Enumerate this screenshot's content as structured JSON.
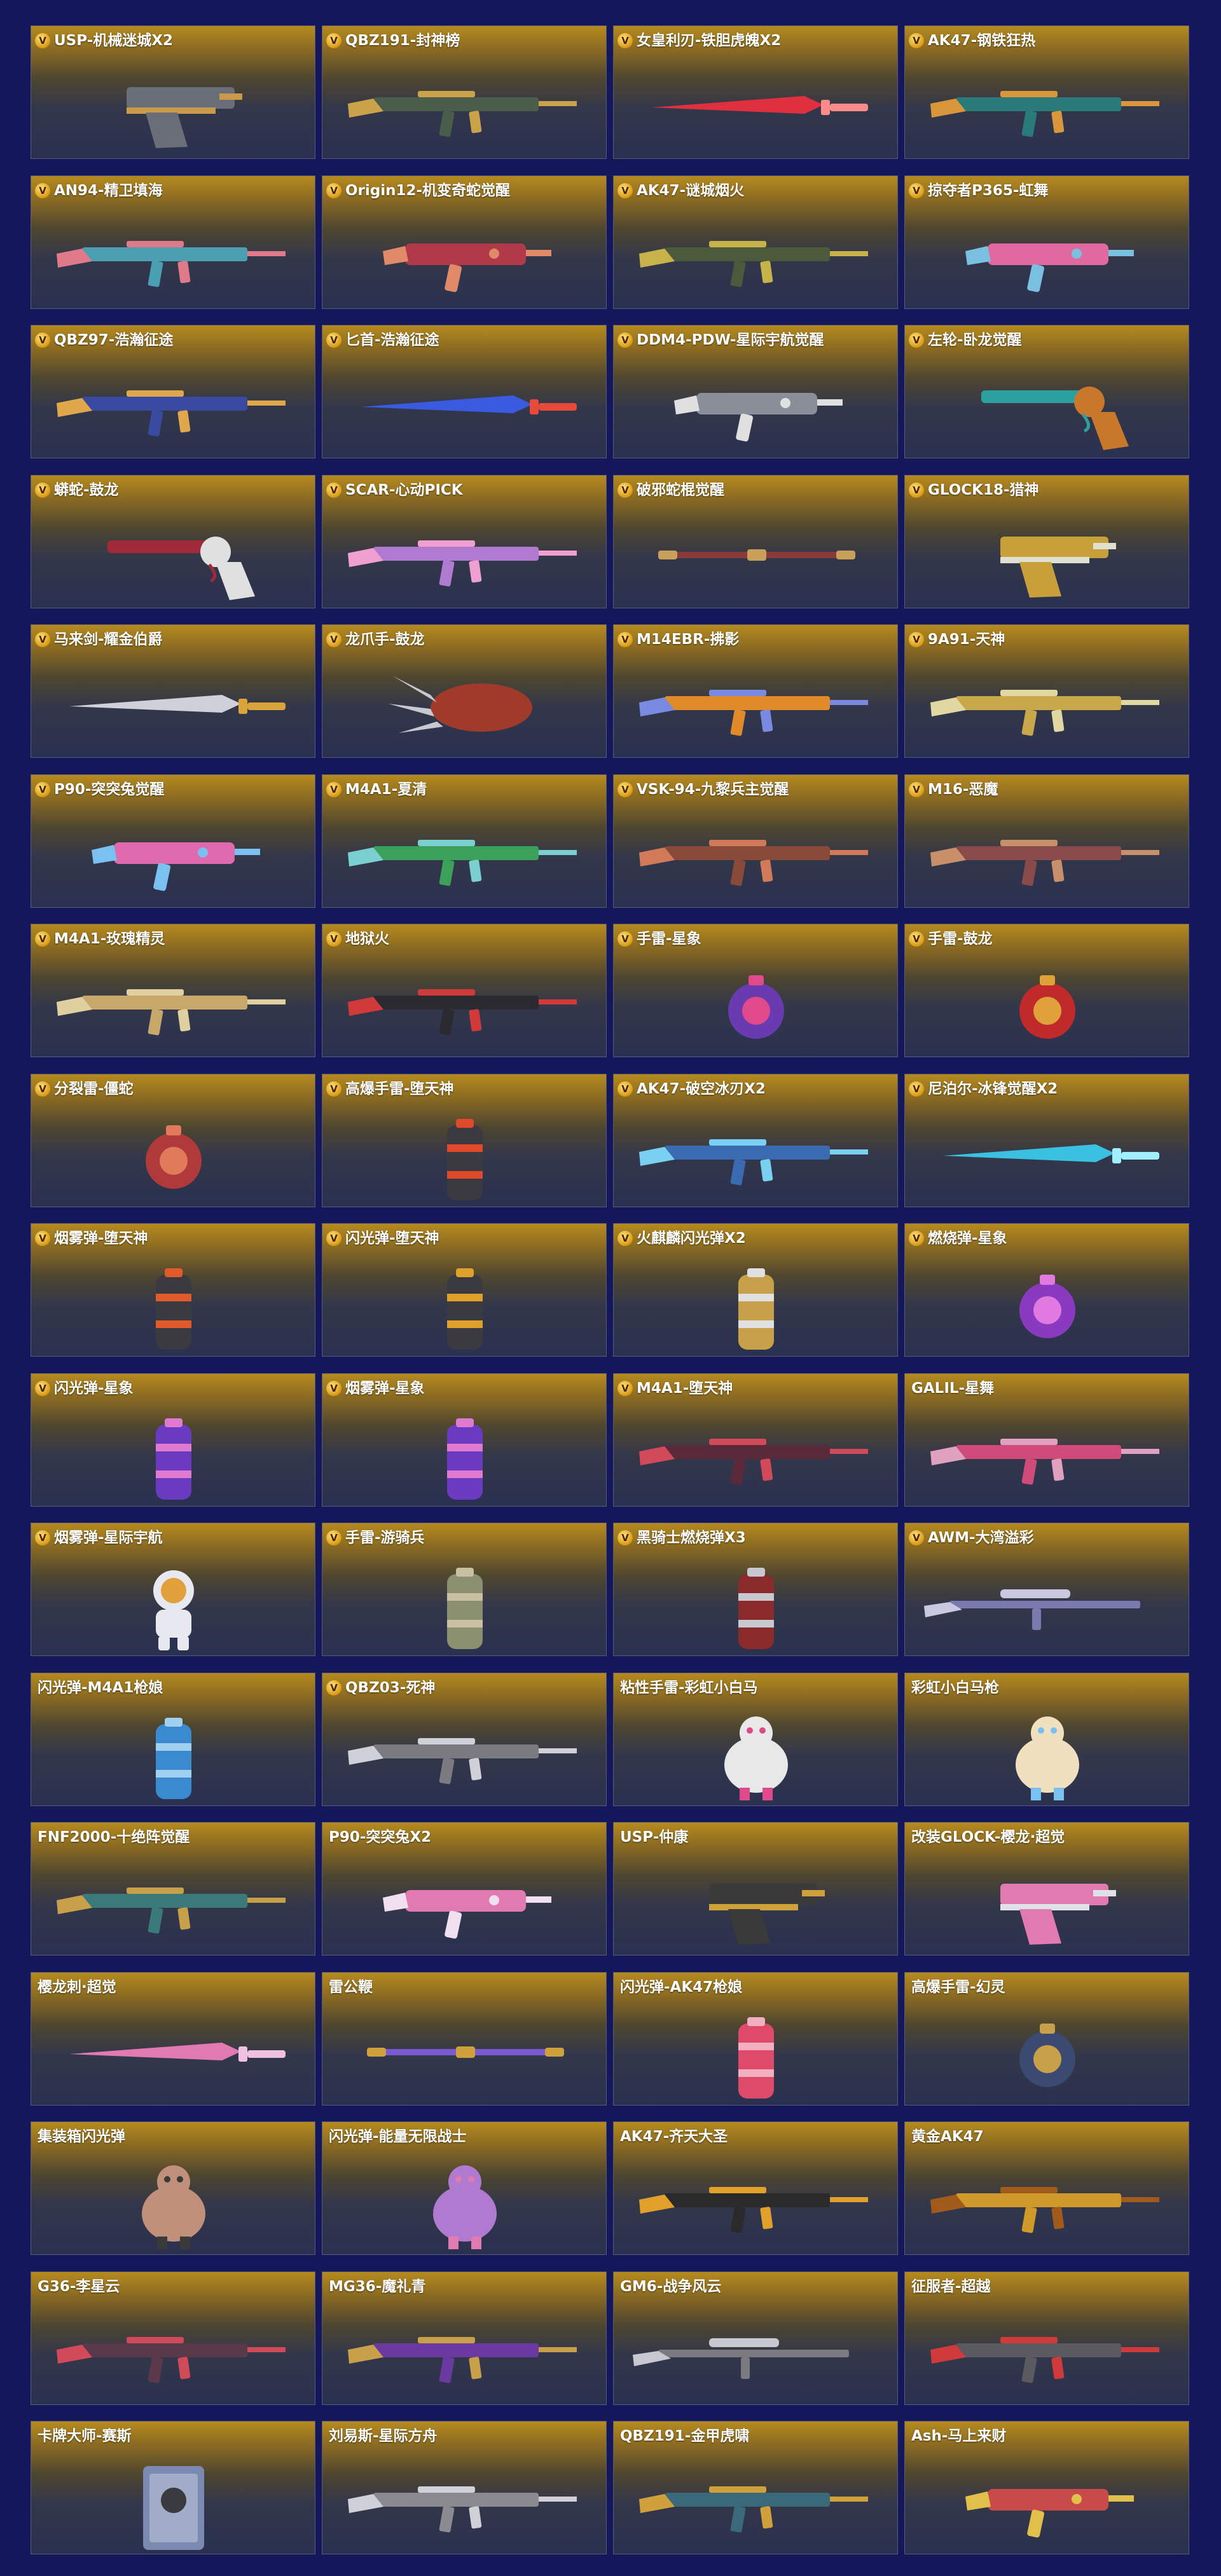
{
  "badge_letter": "V",
  "items": [
    {
      "title": "USP-机械迷城X2",
      "badge": true,
      "icon": "pistol-icon",
      "c1": "#6a6e78",
      "c2": "#c89a4a"
    },
    {
      "title": "QBZ191-封神榜",
      "badge": true,
      "icon": "rifle-icon",
      "c1": "#4a5c4a",
      "c2": "#c9a24a"
    },
    {
      "title": "女皇利刃-铁胆虎魄X2",
      "badge": true,
      "icon": "blade-icon",
      "c1": "#e03040",
      "c2": "#ff8a8a"
    },
    {
      "title": "AK47-钢铁狂热",
      "badge": true,
      "icon": "rifle-icon",
      "c1": "#2a7a7a",
      "c2": "#d9963a"
    },
    {
      "title": "AN94-精卫填海",
      "badge": true,
      "icon": "rifle-icon",
      "c1": "#4aa0b0",
      "c2": "#e07a8a"
    },
    {
      "title": "Origin12-机变奇蛇觉醒",
      "badge": true,
      "icon": "smg-icon",
      "c1": "#b03a4a",
      "c2": "#e08a6a"
    },
    {
      "title": "AK47-谜城烟火",
      "badge": true,
      "icon": "rifle-icon",
      "c1": "#4a5a3a",
      "c2": "#c8b24a"
    },
    {
      "title": "掠夺者P365-虹舞",
      "badge": true,
      "icon": "smg-icon",
      "c1": "#e06aa0",
      "c2": "#7ac0e0"
    },
    {
      "title": "QBZ97-浩瀚征途",
      "badge": true,
      "icon": "rifle-icon",
      "c1": "#3a4aa0",
      "c2": "#e0a84a"
    },
    {
      "title": "匕首-浩瀚征途",
      "badge": true,
      "icon": "blade-icon",
      "c1": "#3a5ae0",
      "c2": "#e84a3a"
    },
    {
      "title": "DDM4-PDW-星际宇航觉醒",
      "badge": true,
      "icon": "smg-icon",
      "c1": "#8a8e98",
      "c2": "#e0e0e0"
    },
    {
      "title": "左轮-卧龙觉醒",
      "badge": true,
      "icon": "revolver-icon",
      "c1": "#2aa0a0",
      "c2": "#c8782a"
    },
    {
      "title": "蟒蛇-鼓龙",
      "badge": true,
      "icon": "revolver-icon",
      "c1": "#a02a3a",
      "c2": "#e0e0e0"
    },
    {
      "title": "SCAR-心动PICK",
      "badge": true,
      "icon": "rifle-icon",
      "c1": "#b07ad0",
      "c2": "#f0a0d0"
    },
    {
      "title": "破邪蛇棍觉醒",
      "badge": true,
      "icon": "staff-icon",
      "c1": "#8a3a3a",
      "c2": "#c8a05a"
    },
    {
      "title": "GLOCK18-猎神",
      "badge": true,
      "icon": "pistol-icon",
      "c1": "#c8a03a",
      "c2": "#e0e0d0"
    },
    {
      "title": "马来剑-耀金伯爵",
      "badge": true,
      "icon": "blade-icon",
      "c1": "#d0d0d8",
      "c2": "#d9a43a"
    },
    {
      "title": "龙爪手-鼓龙",
      "badge": true,
      "icon": "claw-icon",
      "c1": "#a03a2a",
      "c2": "#c8c8d0"
    },
    {
      "title": "M14EBR-拂影",
      "badge": true,
      "icon": "rifle-icon",
      "c1": "#e08a2a",
      "c2": "#7a8ae0"
    },
    {
      "title": "9A91-天神",
      "badge": true,
      "icon": "rifle-icon",
      "c1": "#c8a84a",
      "c2": "#e0d8a0"
    },
    {
      "title": "P90-突突兔觉醒",
      "badge": true,
      "icon": "smg-icon",
      "c1": "#e06ab0",
      "c2": "#7ac0f0"
    },
    {
      "title": "M4A1-夏清",
      "badge": true,
      "icon": "rifle-icon",
      "c1": "#3aa05a",
      "c2": "#7ad0d0"
    },
    {
      "title": "VSK-94-九黎兵主觉醒",
      "badge": true,
      "icon": "rifle-icon",
      "c1": "#8a4a3a",
      "c2": "#d07a5a"
    },
    {
      "title": "M16-恶魔",
      "badge": true,
      "icon": "rifle-icon",
      "c1": "#8a4a4a",
      "c2": "#c8906a"
    },
    {
      "title": "M4A1-玫瑰精灵",
      "badge": true,
      "icon": "rifle-icon",
      "c1": "#c8a86a",
      "c2": "#e0d0a0"
    },
    {
      "title": "地狱火",
      "badge": true,
      "icon": "rifle-icon",
      "c1": "#2a2a30",
      "c2": "#d03a3a"
    },
    {
      "title": "手雷-星象",
      "badge": true,
      "icon": "grenade-icon",
      "c1": "#6a3ab0",
      "c2": "#e04a8a"
    },
    {
      "title": "手雷-鼓龙",
      "badge": true,
      "icon": "grenade-icon",
      "c1": "#c02a2a",
      "c2": "#e0a03a"
    },
    {
      "title": "分裂雷-僵蛇",
      "badge": true,
      "icon": "grenade-icon",
      "c1": "#b03a3a",
      "c2": "#e07a5a"
    },
    {
      "title": "高爆手雷-堕天神",
      "badge": true,
      "icon": "canister-icon",
      "c1": "#3a3a40",
      "c2": "#e04a2a"
    },
    {
      "title": "AK47-破空冰刃X2",
      "badge": true,
      "icon": "rifle-icon",
      "c1": "#3a6ab0",
      "c2": "#7ad0f0"
    },
    {
      "title": "尼泊尔-冰锋觉醒X2",
      "badge": true,
      "icon": "blade-icon",
      "c1": "#3ac0e0",
      "c2": "#a0f0ff"
    },
    {
      "title": "烟雾弹-堕天神",
      "badge": true,
      "icon": "canister-icon",
      "c1": "#3a3a40",
      "c2": "#e05a2a"
    },
    {
      "title": "闪光弹-堕天神",
      "badge": true,
      "icon": "canister-icon",
      "c1": "#3a3a40",
      "c2": "#e0a02a"
    },
    {
      "title": "火麒麟闪光弹X2",
      "badge": true,
      "icon": "canister-icon",
      "c1": "#c8a04a",
      "c2": "#e0e0e0"
    },
    {
      "title": "燃烧弹-星象",
      "badge": true,
      "icon": "grenade-icon",
      "c1": "#8a3ac0",
      "c2": "#e07ae0"
    },
    {
      "title": "闪光弹-星象",
      "badge": true,
      "icon": "canister-icon",
      "c1": "#6a3ac0",
      "c2": "#e07ad0"
    },
    {
      "title": "烟雾弹-星象",
      "badge": true,
      "icon": "canister-icon",
      "c1": "#6a3ac0",
      "c2": "#e07ad0"
    },
    {
      "title": "M4A1-堕天神",
      "badge": true,
      "icon": "rifle-icon",
      "c1": "#5a2a3a",
      "c2": "#d04a5a"
    },
    {
      "title": "GALIL-星舞",
      "badge": false,
      "icon": "rifle-icon",
      "c1": "#d04a7a",
      "c2": "#e0a0c0"
    },
    {
      "title": "烟雾弹-星际宇航",
      "badge": true,
      "icon": "astronaut-icon",
      "c1": "#e8e8f0",
      "c2": "#e0a03a"
    },
    {
      "title": "手雷-游骑兵",
      "badge": true,
      "icon": "canister-icon",
      "c1": "#8a9070",
      "c2": "#c8c0a0"
    },
    {
      "title": "黑骑士燃烧弹X3",
      "badge": true,
      "icon": "canister-icon",
      "c1": "#8a2a2a",
      "c2": "#c8c8d0"
    },
    {
      "title": "AWM-大湾溢彩",
      "badge": true,
      "icon": "sniper-icon",
      "c1": "#7a7ab0",
      "c2": "#c8c8e0"
    },
    {
      "title": "闪光弹-M4A1枪娘",
      "badge": false,
      "icon": "canister-icon",
      "c1": "#3a8ad0",
      "c2": "#a0d0f0"
    },
    {
      "title": "QBZ03-死神",
      "badge": true,
      "icon": "rifle-icon",
      "c1": "#7a7a80",
      "c2": "#d0d0d8"
    },
    {
      "title": "粘性手雷-彩虹小白马",
      "badge": false,
      "icon": "mascot-icon",
      "c1": "#e8e8e8",
      "c2": "#e04a8a"
    },
    {
      "title": "彩虹小白马枪",
      "badge": false,
      "icon": "mascot-icon",
      "c1": "#f0e0c0",
      "c2": "#7ac0f0"
    },
    {
      "title": "FNF2000-十绝阵觉醒",
      "badge": false,
      "icon": "rifle-icon",
      "c1": "#3a7a7a",
      "c2": "#c8a04a"
    },
    {
      "title": "P90-突突兔X2",
      "badge": false,
      "icon": "smg-icon",
      "c1": "#e07ab0",
      "c2": "#f0e0f0"
    },
    {
      "title": "USP-仲康",
      "badge": false,
      "icon": "pistol-icon",
      "c1": "#3a3a3a",
      "c2": "#d0a03a"
    },
    {
      "title": "改装GLOCK-樱龙·超觉",
      "badge": false,
      "icon": "pistol-icon",
      "c1": "#e07ab0",
      "c2": "#e0e0e8"
    },
    {
      "title": "樱龙刺·超觉",
      "badge": false,
      "icon": "blade-icon",
      "c1": "#e07ab0",
      "c2": "#f0c0e0"
    },
    {
      "title": "雷公鞭",
      "badge": false,
      "icon": "staff-icon",
      "c1": "#7a5ad0",
      "c2": "#d0a03a"
    },
    {
      "title": "闪光弹-AK47枪娘",
      "badge": false,
      "icon": "canister-icon",
      "c1": "#e04a6a",
      "c2": "#f0b0c0"
    },
    {
      "title": "高爆手雷-幻灵",
      "badge": false,
      "icon": "grenade-icon",
      "c1": "#3a4a70",
      "c2": "#c8a04a"
    },
    {
      "title": "集装箱闪光弹",
      "badge": false,
      "icon": "mascot-icon",
      "c1": "#c0907a",
      "c2": "#3a3a3a"
    },
    {
      "title": "闪光弹-能量无限战士",
      "badge": false,
      "icon": "mascot-icon",
      "c1": "#b07ad0",
      "c2": "#e07ab0"
    },
    {
      "title": "AK47-齐天大圣",
      "badge": false,
      "icon": "rifle-icon",
      "c1": "#2a2a2a",
      "c2": "#e0a02a"
    },
    {
      "title": "黄金AK47",
      "badge": false,
      "icon": "rifle-icon",
      "c1": "#d09a2a",
      "c2": "#a05a1a"
    },
    {
      "title": "G36-李星云",
      "badge": false,
      "icon": "rifle-icon",
      "c1": "#5a3a4a",
      "c2": "#d04a5a"
    },
    {
      "title": "MG36-魔礼青",
      "badge": false,
      "icon": "rifle-icon",
      "c1": "#6a3aa0",
      "c2": "#c8a04a"
    },
    {
      "title": "GM6-战争风云",
      "badge": false,
      "icon": "sniper-icon",
      "c1": "#7a7a80",
      "c2": "#c8c8d0"
    },
    {
      "title": "征服者-超越",
      "badge": false,
      "icon": "rifle-icon",
      "c1": "#5a5a60",
      "c2": "#d03a3a"
    },
    {
      "title": "卡牌大师-赛斯",
      "badge": false,
      "icon": "card-icon",
      "c1": "#7a8ab0",
      "c2": "#c8d0e0"
    },
    {
      "title": "刘易斯-星际方舟",
      "badge": false,
      "icon": "rifle-icon",
      "c1": "#8a8a90",
      "c2": "#d0d0d8"
    },
    {
      "title": "QBZ191-金甲虎啸",
      "badge": false,
      "icon": "rifle-icon",
      "c1": "#3a6a7a",
      "c2": "#d0a03a"
    },
    {
      "title": "Ash-马上来财",
      "badge": false,
      "icon": "smg-icon",
      "c1": "#c84a4a",
      "c2": "#e0c04a"
    }
  ]
}
